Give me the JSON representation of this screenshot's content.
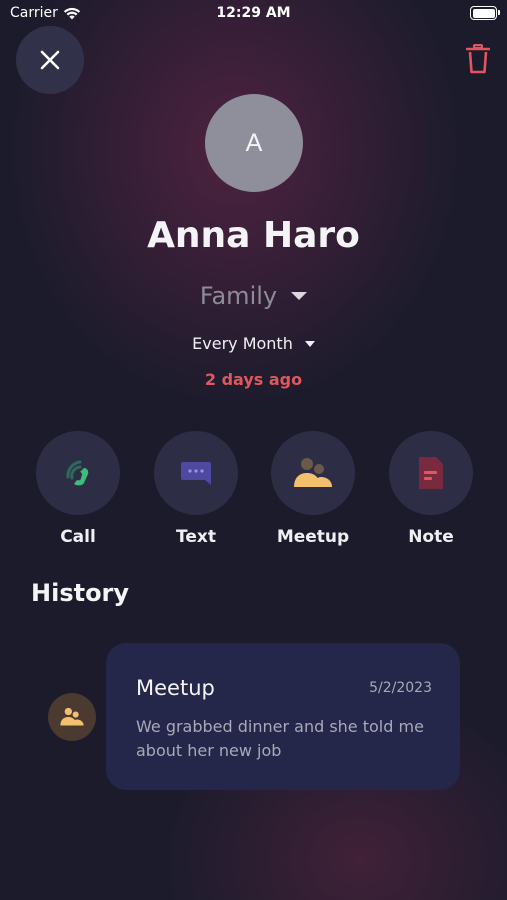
{
  "status_bar": {
    "carrier": "Carrier",
    "time": "12:29 AM"
  },
  "header": {
    "close_icon": "close-icon",
    "delete_icon": "trash-icon"
  },
  "contact": {
    "avatar_initial": "A",
    "name": "Anna Haro",
    "group": "Family",
    "frequency": "Every Month",
    "last_contact": "2 days ago"
  },
  "actions": [
    {
      "label": "Call",
      "icon": "phone-icon",
      "color": "#3dbd7d"
    },
    {
      "label": "Text",
      "icon": "message-icon",
      "color": "#4f4aa0"
    },
    {
      "label": "Meetup",
      "icon": "people-icon",
      "color": "#f3c06f"
    },
    {
      "label": "Note",
      "icon": "note-icon",
      "color": "#7a2a3e"
    }
  ],
  "history": {
    "title": "History",
    "entries": [
      {
        "type": "Meetup",
        "date": "5/2/2023",
        "note": "We grabbed dinner and she told me about her new job",
        "icon": "people-icon"
      }
    ]
  },
  "colors": {
    "background": "#1b1b2c",
    "accent_red": "#e0585e",
    "card": "#24264a"
  }
}
